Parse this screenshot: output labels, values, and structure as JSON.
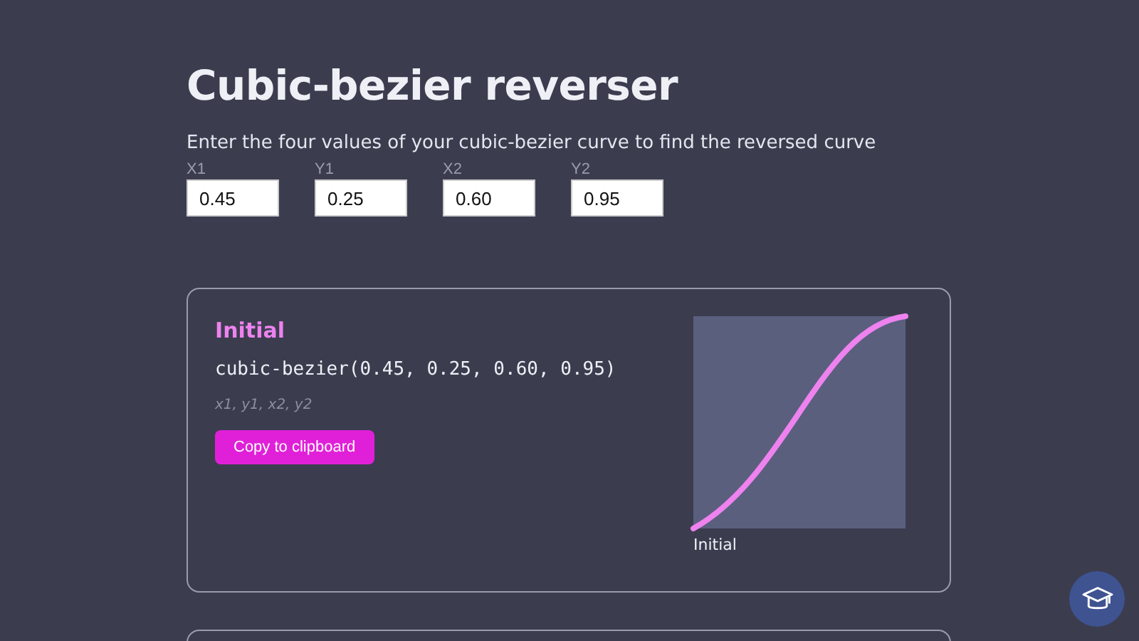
{
  "title": "Cubic-bezier reverser",
  "description": "Enter the four values of your cubic-bezier curve to find the reversed curve",
  "inputs": [
    {
      "label": "X1",
      "value": "0.45"
    },
    {
      "label": "Y1",
      "value": "0.25"
    },
    {
      "label": "X2",
      "value": "0.60"
    },
    {
      "label": "Y2",
      "value": "0.95"
    }
  ],
  "cards": [
    {
      "title": "Initial",
      "code": "cubic-bezier(0.45, 0.25, 0.60, 0.95)",
      "hint": "x1, y1, x2, y2",
      "button": "Copy to clipboard",
      "caption": "Initial"
    }
  ]
}
